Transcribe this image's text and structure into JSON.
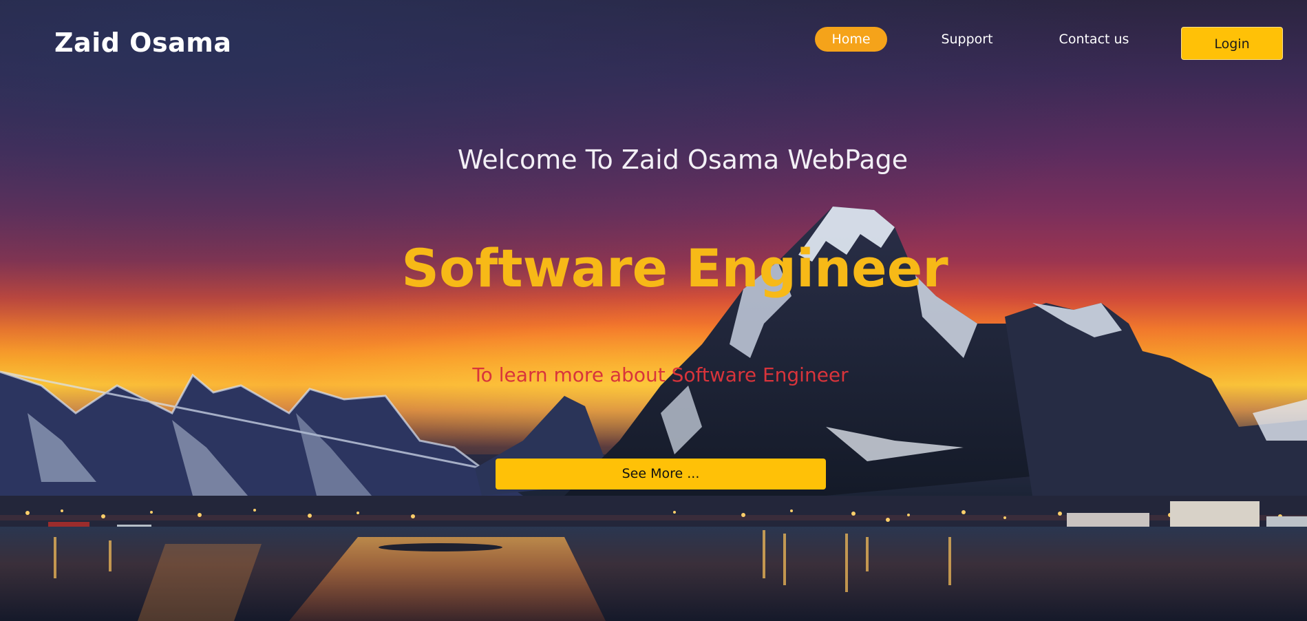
{
  "brand": {
    "name": "Zaid Osama"
  },
  "nav": {
    "items": [
      {
        "label": "Home",
        "active": true
      },
      {
        "label": "Support",
        "active": false
      },
      {
        "label": "Contact us",
        "active": false
      }
    ],
    "login_label": "Login"
  },
  "hero": {
    "welcome": "Welcome To Zaid Osama WebPage",
    "headline": "Software Engineer",
    "subline": "To learn more about Software Engineer",
    "cta_label": "See More ..."
  },
  "colors": {
    "accent_yellow": "#ffc107",
    "nav_active": "#f5a31a",
    "headline": "#f7b917",
    "subline": "#d8343b"
  },
  "background": {
    "description_icon": "mountain-lake-sunset-image"
  }
}
